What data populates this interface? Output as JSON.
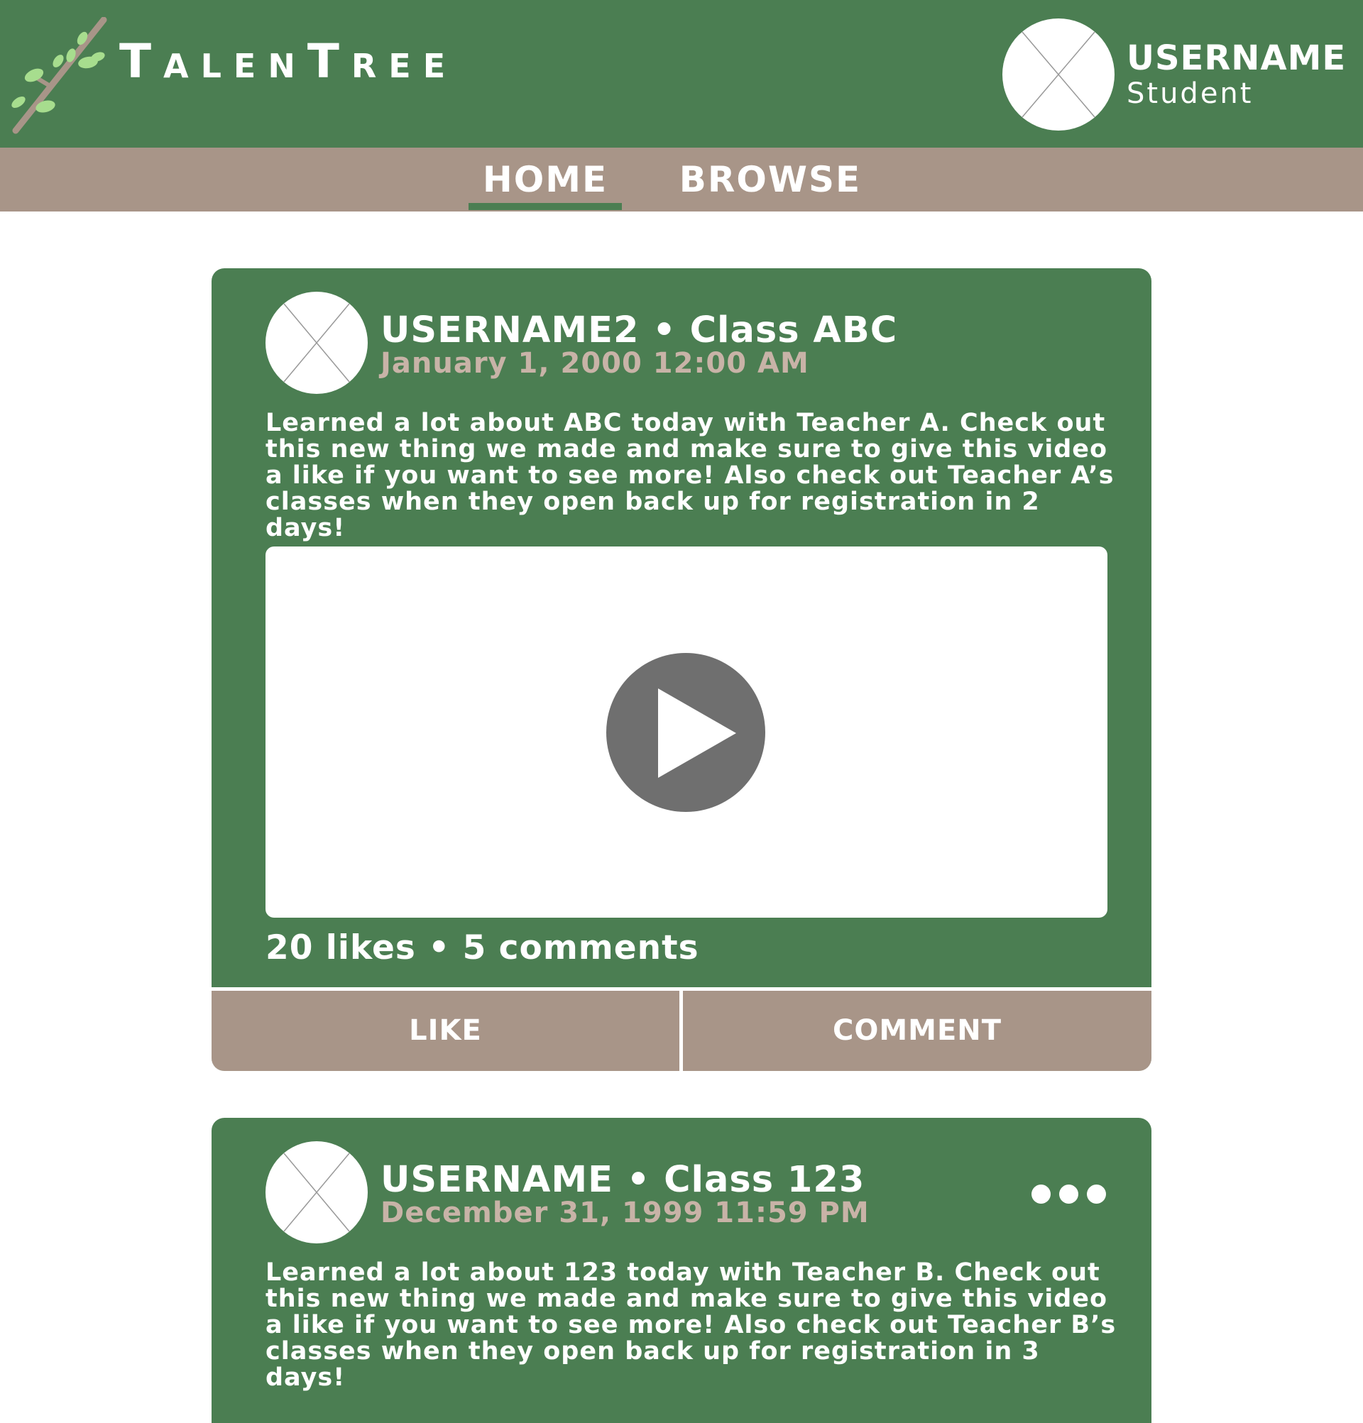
{
  "brand": {
    "name": "TalenTree",
    "logo_icon": "tree-branch-icon"
  },
  "user": {
    "name": "USERNAME",
    "role": "Student",
    "avatar_icon": "avatar-placeholder-icon"
  },
  "nav": {
    "tabs": [
      {
        "label": "HOME",
        "active": true
      },
      {
        "label": "BROWSE",
        "active": false
      }
    ]
  },
  "posts": [
    {
      "header": "USERNAME2 • Class ABC",
      "date": "January 1, 2000 12:00 AM",
      "text": "Learned a lot about ABC today with Teacher A. Check out this new thing we made and make sure to give this video a like if you want to see more! Also check out Teacher A’s classes when they open back up for registration in 2 days!",
      "stats": "20 likes • 5 comments",
      "like_label": "LIKE",
      "comment_label": "COMMENT",
      "media_icon": "play-icon"
    },
    {
      "header": "USERNAME • Class 123",
      "date": "December 31, 1999 11:59 PM",
      "text": "Learned a lot about 123 today with Teacher B. Check out this new thing we made and make sure to give this video a like if you want to see more! Also check out Teacher B’s classes when they open back up for registration in 3 days!",
      "menu_icon": "more-options-icon"
    }
  ],
  "colors": {
    "primary_green": "#4b7e52",
    "taupe": "#a89588",
    "date_text": "#c8b3a7",
    "play_button": "#6f6f6f",
    "white": "#ffffff"
  }
}
